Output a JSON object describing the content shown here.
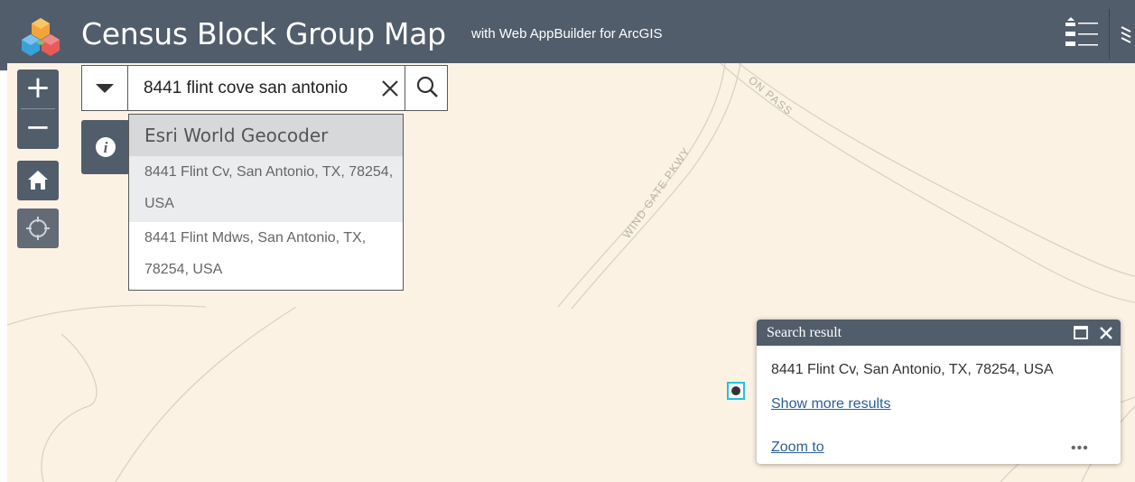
{
  "app": {
    "title": "Census Block Group Map",
    "subtitle": "with Web AppBuilder for ArcGIS"
  },
  "map": {
    "street_labels": [
      "WIND GATE PKWY",
      "ON PASS"
    ]
  },
  "search": {
    "value": "8441 flint cove san antonio",
    "suggestions": {
      "source": "Esri World Geocoder",
      "items": [
        "8441 Flint Cv, San Antonio, TX, 78254, USA",
        "8441 Flint Mdws, San Antonio, TX, 78254, USA"
      ]
    }
  },
  "popup": {
    "title": "Search result",
    "address": "8441 Flint Cv, San Antonio, TX, 78254, USA",
    "show_more": "Show more results",
    "zoom_to": "Zoom to",
    "menu": "•••"
  },
  "controls": {
    "zoom_in": "+",
    "zoom_out": "−",
    "info": "i"
  },
  "colors": {
    "header": "#525d6b",
    "map_bg": "#fcf2e4",
    "link": "#2b5f93",
    "marker_outline": "#22c3d8"
  },
  "icons": [
    "app-logo-icon",
    "menu-list-icon",
    "more-icon",
    "home-icon",
    "locate-icon",
    "info-icon",
    "chevron-down-icon",
    "close-icon",
    "search-icon",
    "maximize-icon"
  ]
}
